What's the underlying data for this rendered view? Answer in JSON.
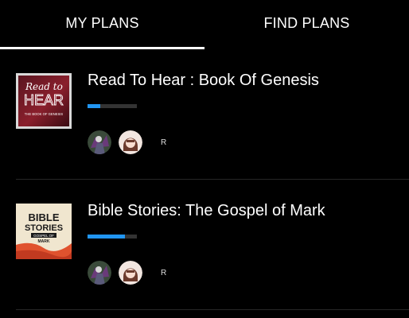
{
  "tabs": {
    "my_plans": "MY PLANS",
    "find_plans": "FIND PLANS",
    "active": "my_plans"
  },
  "plans": [
    {
      "title": "Read To Hear : Book Of Genesis",
      "progress": 0.25,
      "thumbnail": {
        "script_text": "Read to",
        "main_text": "HEAR",
        "sub_text": "THE BOOK OF GENESIS"
      },
      "friend_initial": "R"
    },
    {
      "title": "Bible Stories: The Gospel of Mark",
      "progress": 0.75,
      "thumbnail": {
        "main_line1": "BIBLE",
        "main_line2": "STORIES",
        "sub_line1": "GOSPEL OF",
        "sub_line2": "MARK"
      },
      "friend_initial": "R"
    }
  ],
  "colors": {
    "background": "#000000",
    "accent": "#2196f3",
    "progress_track": "#333333",
    "divider": "#262626"
  }
}
